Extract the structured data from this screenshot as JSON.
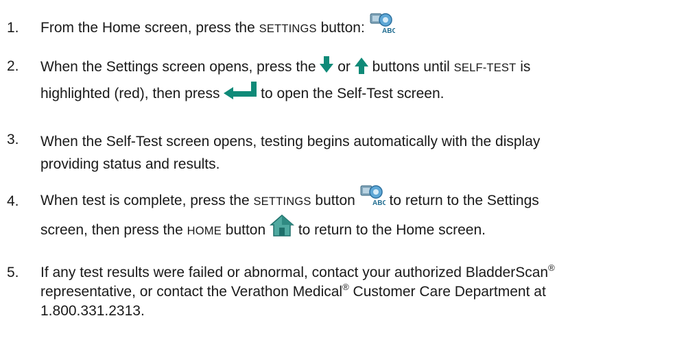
{
  "steps": [
    {
      "number": "1.",
      "t1": "From the Home screen, press the ",
      "settings_button": "SETTINGS",
      "t2": " button:"
    },
    {
      "number": "2.",
      "t1": "When the Settings screen opens, press the ",
      "t2": " or ",
      "t3": " buttons until ",
      "self_test": "SELF-TEST",
      "t4": " is",
      "t5": "highlighted (red), then press ",
      "t6": " to open the Self-Test screen."
    },
    {
      "number": "3.",
      "line1": "When the Self-Test screen opens, testing begins automatically with the display",
      "line2": "providing status and results."
    },
    {
      "number": "4.",
      "t1": "When test is complete, press the ",
      "settings_button": "SETTINGS",
      "t2": " button ",
      "t3": " to return to the Settings",
      "t4": "screen, then press the ",
      "home_button": "HOME",
      "t5": " button ",
      "t6": " to return to the Home screen."
    },
    {
      "number": "5.",
      "t1": "If any test results were failed or abnormal, contact your authorized BladderScan",
      "reg1": "®",
      "t2": "representative, or contact the Verathon Medical",
      "reg2": "®",
      "t3": " Customer Care Department at",
      "t4": "1.800.331.2313."
    }
  ],
  "icons": {
    "settings": "settings-abc-icon",
    "down": "down-arrow-icon",
    "up": "up-arrow-icon",
    "enter": "enter-arrow-icon",
    "home": "home-icon"
  },
  "colors": {
    "text": "#1a1a1a",
    "arrow_teal": "#0f8a78",
    "icon_blue": "#3b8fc8"
  }
}
